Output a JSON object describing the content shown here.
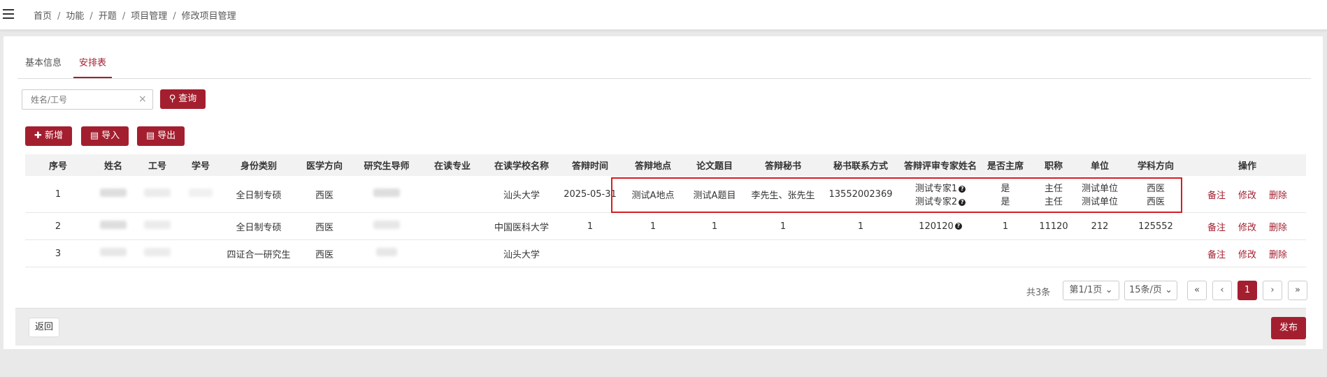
{
  "breadcrumb": [
    "首页",
    "功能",
    "开题",
    "项目管理",
    "修改项目管理"
  ],
  "tabs": [
    "基本信息",
    "安排表"
  ],
  "search": {
    "placeholder": "姓名/工号",
    "query_label": "查询"
  },
  "actions": {
    "add": "新增",
    "import": "导入",
    "export": "导出"
  },
  "columns": [
    "序号",
    "姓名",
    "工号",
    "学号",
    "身份类别",
    "医学方向",
    "研究生导师",
    "在读专业",
    "在读学校名称",
    "答辩时间",
    "答辩地点",
    "论文题目",
    "答辩秘书",
    "秘书联系方式",
    "答辩评审专家姓名",
    "是否主席",
    "职称",
    "单位",
    "学科方向",
    "操作"
  ],
  "rows": [
    {
      "no": "1",
      "identity": "全日制专硕",
      "direction": "西医",
      "major": "",
      "school": "汕头大学",
      "time": "2025-05-31",
      "place": "测试A地点",
      "topic": "测试A题目",
      "secretary": "李先生、张先生",
      "phone": "13552002369",
      "experts": [
        "测试专家1",
        "测试专家2"
      ],
      "chair": [
        "是",
        "是"
      ],
      "title": [
        "主任",
        "主任"
      ],
      "unit": [
        "测试单位",
        "测试单位"
      ],
      "subject": [
        "西医",
        "西医"
      ]
    },
    {
      "no": "2",
      "identity": "全日制专硕",
      "direction": "西医",
      "major": "",
      "school": "中国医科大学",
      "time": "1",
      "place": "1",
      "topic": "1",
      "secretary": "1",
      "phone": "1",
      "experts": [
        "120120"
      ],
      "chair": [
        "1"
      ],
      "title": [
        "11120"
      ],
      "unit": [
        "212"
      ],
      "subject": [
        "125552"
      ]
    },
    {
      "no": "3",
      "identity": "四证合一研究生",
      "direction": "西医",
      "major": "",
      "school": "汕头大学",
      "time": "",
      "place": "",
      "topic": "",
      "secretary": "",
      "phone": "",
      "experts": [
        ""
      ],
      "chair": [
        ""
      ],
      "title": [
        ""
      ],
      "unit": [
        ""
      ],
      "subject": [
        ""
      ]
    }
  ],
  "row_ops": {
    "note": "备注",
    "edit": "修改",
    "delete": "删除"
  },
  "pagination": {
    "total": "共3条",
    "page_select": "第1/1页",
    "size_select": "15条/页",
    "first": "«",
    "prev": "‹",
    "current": "1",
    "next": "›",
    "last": "»"
  },
  "footer": {
    "back": "返回",
    "publish": "发布"
  },
  "colors": {
    "accent": "#a31f2f",
    "highlight": "#d41d24"
  }
}
